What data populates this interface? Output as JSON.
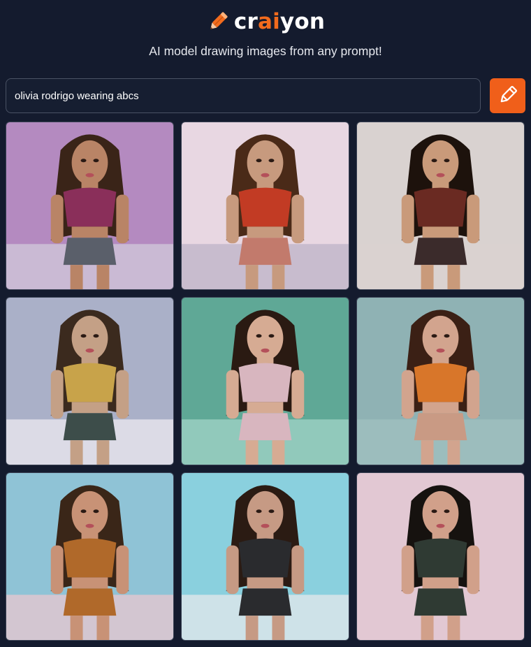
{
  "header": {
    "logo_prefix": "cr",
    "logo_accent": "ai",
    "logo_suffix": "yon",
    "logo_icon": "pencil-icon",
    "tagline": "AI model drawing images from any prompt!"
  },
  "prompt": {
    "value": "olivia rodrigo wearing abcs",
    "button_icon": "pencil-icon"
  },
  "colors": {
    "background": "#141b2e",
    "accent": "#f05f1a",
    "text": "#ffffff"
  },
  "images": [
    {
      "bg": "#b48ac0",
      "skin": "#b98466",
      "hair": "#3a2418",
      "top": "#8a2f5a",
      "bottom": "#5a5f6a",
      "floor": "#cfc6d8"
    },
    {
      "bg": "#e8d7e2",
      "skin": "#c79a7e",
      "hair": "#4a2a18",
      "top": "#c23b24",
      "bottom": "#c27a6c",
      "floor": "#bfb5c9"
    },
    {
      "bg": "#d9d2d0",
      "skin": "#c99a7a",
      "hair": "#1d120c",
      "top": "#6a2a22",
      "bottom": "#3b2b2b",
      "floor": "#d9d2d0"
    },
    {
      "bg": "#aab0c8",
      "skin": "#c4a086",
      "hair": "#3b2a1e",
      "top": "#c8a34a",
      "bottom": "#3d4d4a",
      "floor": "#e9e6ee"
    },
    {
      "bg": "#5fa896",
      "skin": "#d6ab93",
      "hair": "#2a1a12",
      "top": "#d8b6bf",
      "bottom": "#d8b6bf",
      "floor": "#9ed1c4"
    },
    {
      "bg": "#8fb2b4",
      "skin": "#d2a48e",
      "hair": "#3b2015",
      "top": "#d8762a",
      "bottom": "#c99a84",
      "floor": "#9fbfbf"
    },
    {
      "bg": "#8fc3d6",
      "skin": "#c89276",
      "hair": "#3a2618",
      "top": "#b0692a",
      "bottom": "#b0692a",
      "floor": "#e4c7cf"
    },
    {
      "bg": "#8ad0de",
      "skin": "#c69a84",
      "hair": "#2b1b13",
      "top": "#2a2b2e",
      "bottom": "#2a2b2e",
      "floor": "#dfe6ea"
    },
    {
      "bg": "#e2c8d3",
      "skin": "#d1a08a",
      "hair": "#16120f",
      "top": "#2f3a33",
      "bottom": "#2f3a33",
      "floor": "#e2c8d3"
    }
  ]
}
